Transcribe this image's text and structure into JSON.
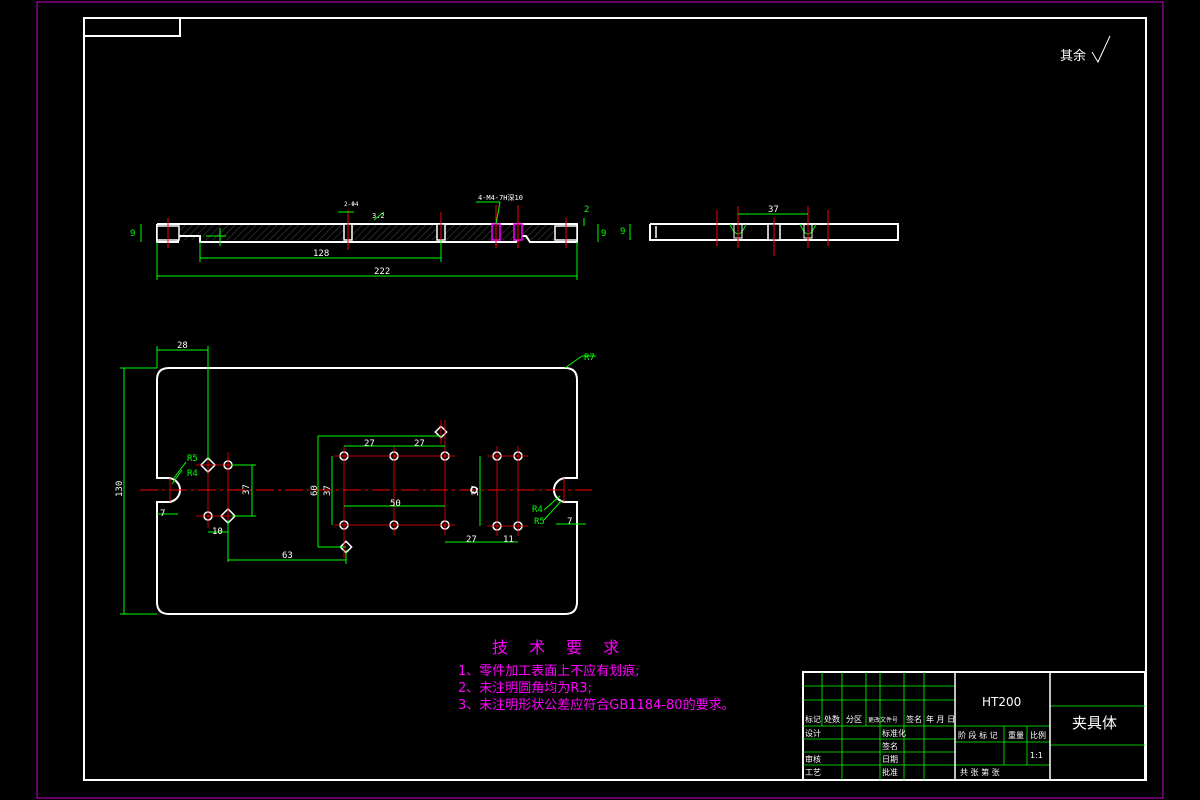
{
  "corner_note": "其余",
  "colors": {
    "outline": "#ffffff",
    "dimension": "#00ff00",
    "center": "#ff0000",
    "text_magenta": "#ff00ff",
    "sheet_border": "#cc00cc"
  },
  "dimensions": {
    "d_128": "128",
    "d_222": "222",
    "d_9a": "9",
    "d_9b": "9",
    "d_2": "2",
    "d_32": "3.2",
    "d_hole_callout": "4-M4-7H深10",
    "d_2phi": "2-Φ4",
    "d_right_37": "37",
    "d_9c": "9",
    "d_9d": "9",
    "d_28": "28",
    "d_r7": "R7",
    "d_130": "130",
    "d_r5a": "R5",
    "d_r4a": "R4",
    "d_7a": "7",
    "d_10": "10",
    "d_37a": "37",
    "d_63": "63",
    "d_27a": "27",
    "d_27b": "27",
    "d_50": "50",
    "d_60": "60",
    "d_37b": "37",
    "d_37c": "37",
    "d_27c": "27",
    "d_11": "11",
    "d_r4b": "R4",
    "d_r5b": "R5",
    "d_7b": "7"
  },
  "tech_requirements": {
    "title": "技 术 要 求",
    "items": [
      "1、零件加工表面上不应有划痕;",
      "2、未注明圆角均为R3;",
      "3、未注明形状公差应符合GB1184-80的要求。"
    ]
  },
  "title_block": {
    "material": "HT200",
    "part_name": "夹具体",
    "scale": "1:1",
    "row_labels": {
      "mark": "标记",
      "count": "处数",
      "zone": "分区",
      "doc_no": "更改文件号",
      "signature": "签名",
      "date": "年 月 日",
      "design": "设计",
      "standardize": "标准化",
      "check": "审核",
      "process": "工艺",
      "approve": "批准",
      "sign2": "签名",
      "date2": "日期",
      "stage_mark": "阶 段 标 记",
      "weight": "重量",
      "ratio": "比例",
      "sheets": "共  张  第  张"
    }
  }
}
